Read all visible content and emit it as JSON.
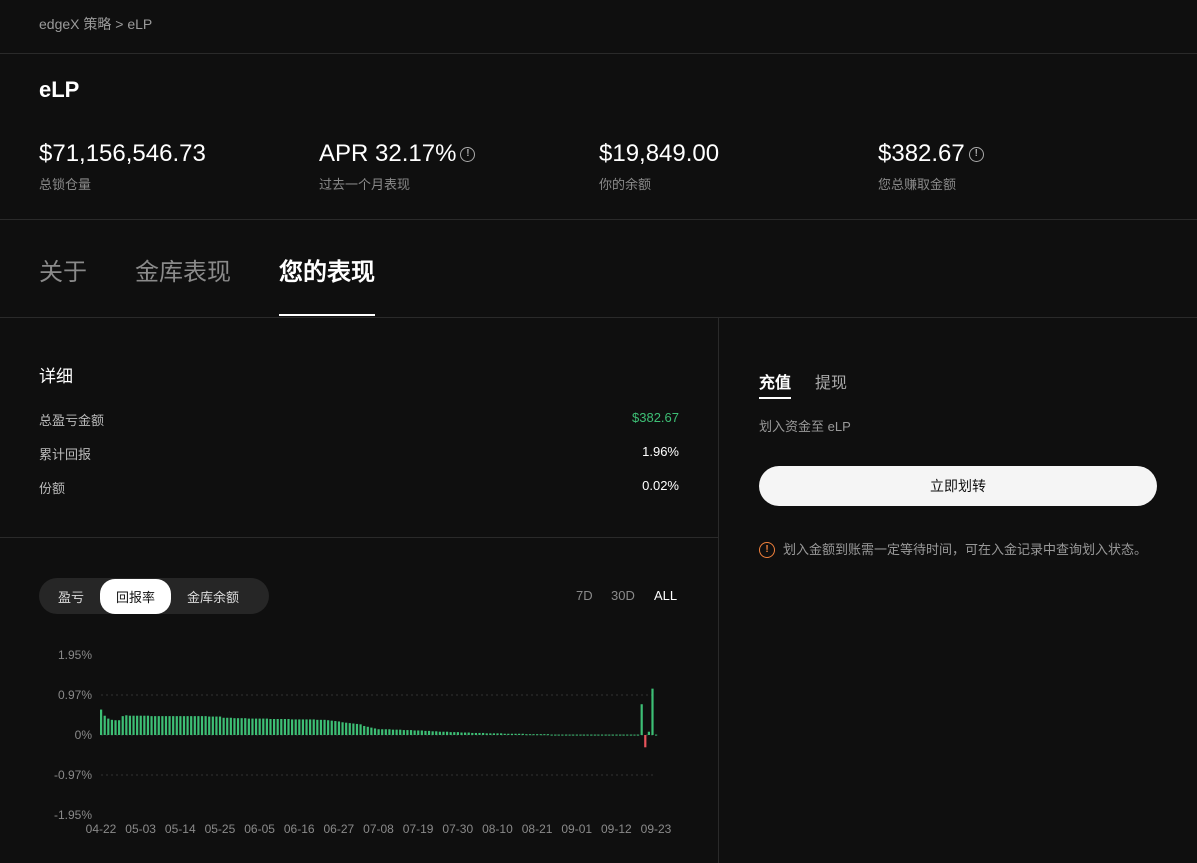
{
  "breadcrumb": {
    "root": "edgeX 策略",
    "separator": ">",
    "current": "eLP"
  },
  "title": "eLP",
  "stats": [
    {
      "value": "$71,156,546.73",
      "label": "总锁仓量",
      "info": false
    },
    {
      "value": "APR 32.17%",
      "label": "过去一个月表现",
      "info": true
    },
    {
      "value": "$19,849.00",
      "label": "你的余额",
      "info": false
    },
    {
      "value": "$382.67",
      "label": "您总赚取金额",
      "info": true
    }
  ],
  "tabs": [
    "关于",
    "金库表现",
    "您的表现"
  ],
  "details": {
    "heading": "详细",
    "rows": [
      {
        "label": "总盈亏金额",
        "value": "$382.67"
      },
      {
        "label": "累计回报",
        "value": "1.96%"
      },
      {
        "label": "份额",
        "value": "0.02%"
      }
    ]
  },
  "chart_controls": {
    "modes": [
      "盈亏",
      "回报率",
      "金库余额"
    ],
    "active_mode": "回报率",
    "ranges": [
      "7D",
      "30D",
      "ALL"
    ],
    "active_range": "ALL"
  },
  "colors": {
    "positive": "#3dbf75",
    "negative": "#e8545c",
    "warning": "#f0803c"
  },
  "chart_data": {
    "type": "bar",
    "title": "",
    "xlabel": "",
    "ylabel": "",
    "yticks": [
      "1.95%",
      "0.97%",
      "0%",
      "-0.97%",
      "-1.95%"
    ],
    "ylim": [
      -1.95,
      1.95
    ],
    "start_date": "04-22",
    "xticks": [
      "04-22",
      "05-03",
      "05-14",
      "05-25",
      "06-05",
      "06-16",
      "06-27",
      "07-08",
      "07-19",
      "07-30",
      "08-10",
      "08-21",
      "09-01",
      "09-12",
      "09-23"
    ],
    "values": [
      0.62,
      0.47,
      0.4,
      0.37,
      0.36,
      0.36,
      0.46,
      0.48,
      0.47,
      0.47,
      0.47,
      0.47,
      0.47,
      0.47,
      0.46,
      0.46,
      0.46,
      0.46,
      0.46,
      0.46,
      0.46,
      0.46,
      0.46,
      0.46,
      0.46,
      0.46,
      0.46,
      0.46,
      0.46,
      0.46,
      0.45,
      0.45,
      0.45,
      0.45,
      0.42,
      0.42,
      0.42,
      0.41,
      0.41,
      0.41,
      0.41,
      0.4,
      0.4,
      0.4,
      0.4,
      0.4,
      0.4,
      0.39,
      0.39,
      0.39,
      0.39,
      0.39,
      0.39,
      0.38,
      0.38,
      0.38,
      0.38,
      0.38,
      0.38,
      0.38,
      0.37,
      0.37,
      0.37,
      0.36,
      0.35,
      0.34,
      0.33,
      0.31,
      0.3,
      0.29,
      0.28,
      0.27,
      0.26,
      0.22,
      0.2,
      0.18,
      0.16,
      0.14,
      0.14,
      0.14,
      0.14,
      0.13,
      0.13,
      0.13,
      0.12,
      0.12,
      0.12,
      0.11,
      0.11,
      0.11,
      0.1,
      0.1,
      0.09,
      0.09,
      0.08,
      0.08,
      0.08,
      0.07,
      0.07,
      0.07,
      0.06,
      0.06,
      0.06,
      0.05,
      0.05,
      0.05,
      0.05,
      0.04,
      0.04,
      0.04,
      0.04,
      0.04,
      0.03,
      0.03,
      0.03,
      0.03,
      0.03,
      0.03,
      0.02,
      0.02,
      0.02,
      0.02,
      0.02,
      0.02,
      0.02,
      0.01,
      0.01,
      0.01,
      0.01,
      0.01,
      0.01,
      0.01,
      0.01,
      0.01,
      0.01,
      0.01,
      0.01,
      0.01,
      0.01,
      0.01,
      0.01,
      0.01,
      0.01,
      0.01,
      0.01,
      0.01,
      0.01,
      0.01,
      0.01,
      0.01,
      0.75,
      -0.3,
      0.08,
      1.13,
      0.01
    ]
  },
  "right": {
    "tabs": [
      "充值",
      "提现"
    ],
    "subtitle": "划入资金至 eLP",
    "button": "立即划转",
    "warning": "划入金额到账需一定等待时间，可在入金记录中查询划入状态。",
    "warning_icon": "!"
  }
}
